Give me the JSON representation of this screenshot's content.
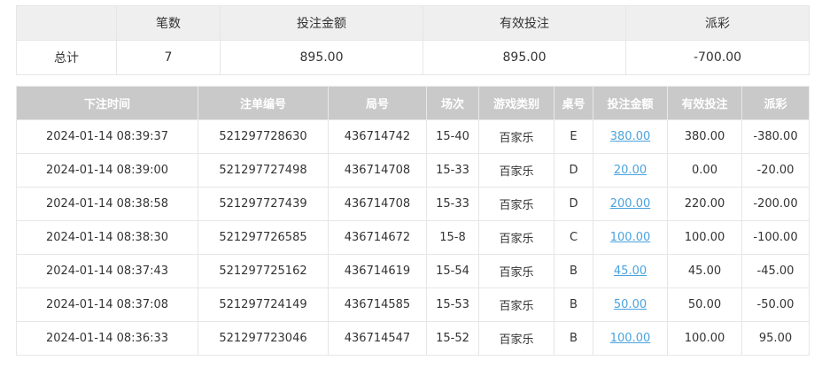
{
  "summary": {
    "headers": [
      "笔数",
      "投注金额",
      "有效投注",
      "派彩"
    ],
    "row_label": "总计",
    "count": "7",
    "bet_amount": "895.00",
    "valid_bet": "895.00",
    "payout": "-700.00"
  },
  "detail": {
    "headers": [
      "下注时间",
      "注单编号",
      "局号",
      "场次",
      "游戏类别",
      "桌号",
      "投注金额",
      "有效投注",
      "派彩"
    ],
    "rows": [
      {
        "time": "2024-01-14 08:39:37",
        "order_no": "521297728630",
        "round_no": "436714742",
        "session": "15-40",
        "game": "百家乐",
        "table": "E",
        "bet": "380.00",
        "valid": "380.00",
        "payout": "-380.00",
        "negative": true
      },
      {
        "time": "2024-01-14 08:39:00",
        "order_no": "521297727498",
        "round_no": "436714708",
        "session": "15-33",
        "game": "百家乐",
        "table": "D",
        "bet": "20.00",
        "valid": "0.00",
        "payout": "-20.00",
        "negative": true
      },
      {
        "time": "2024-01-14 08:38:58",
        "order_no": "521297727439",
        "round_no": "436714708",
        "session": "15-33",
        "game": "百家乐",
        "table": "D",
        "bet": "200.00",
        "valid": "220.00",
        "payout": "-200.00",
        "negative": true
      },
      {
        "time": "2024-01-14 08:38:30",
        "order_no": "521297726585",
        "round_no": "436714672",
        "session": "15-8",
        "game": "百家乐",
        "table": "C",
        "bet": "100.00",
        "valid": "100.00",
        "payout": "-100.00",
        "negative": true
      },
      {
        "time": "2024-01-14 08:37:43",
        "order_no": "521297725162",
        "round_no": "436714619",
        "session": "15-54",
        "game": "百家乐",
        "table": "B",
        "bet": "45.00",
        "valid": "45.00",
        "payout": "-45.00",
        "negative": true
      },
      {
        "time": "2024-01-14 08:37:08",
        "order_no": "521297724149",
        "round_no": "436714585",
        "session": "15-53",
        "game": "百家乐",
        "table": "B",
        "bet": "50.00",
        "valid": "50.00",
        "payout": "-50.00",
        "negative": true
      },
      {
        "time": "2024-01-14 08:36:33",
        "order_no": "521297723046",
        "round_no": "436714547",
        "session": "15-52",
        "game": "百家乐",
        "table": "B",
        "bet": "100.00",
        "valid": "100.00",
        "payout": "95.00",
        "negative": false
      }
    ]
  },
  "colors": {
    "negative": "#f0525b",
    "link": "#4aa3df",
    "detail_header_bg": "#c9c9c9",
    "summary_header_bg": "#efefef"
  }
}
